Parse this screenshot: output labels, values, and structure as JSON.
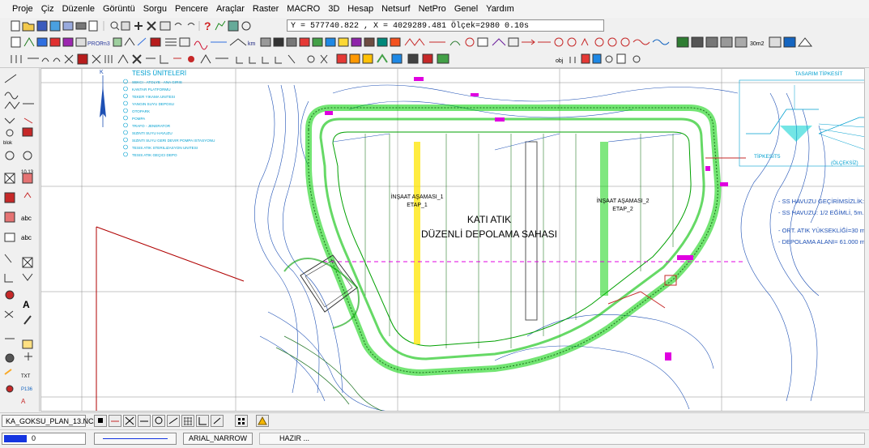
{
  "menu": [
    "Proje",
    "Çiz",
    "Düzenle",
    "Görüntü",
    "Sorgu",
    "Pencere",
    "Araçlar",
    "Raster",
    "MACRO",
    "3D",
    "Hesap",
    "Netsurf",
    "NetPro",
    "Genel",
    "Yardım"
  ],
  "coord_readout": "Y = 577740.822 , X = 4029289.481  Ölçek=2980   0.10s",
  "drawing": {
    "site_title_line1": "KATI ATIK",
    "site_title_line2": "DÜZENLİ DEPOLAMA SAHASI",
    "stage1_line1": "İNŞAAT AŞAMASI_1",
    "stage1_line2": "ETAP_1",
    "stage2_line1": "İNŞAAT AŞAMASI_2",
    "stage2_line2": "ETAP_2",
    "legend_title": "TESİS ÜNİTELERİ",
    "legend_items": [
      "SEKCI - ATOLYE - ANA GIRIS",
      "KANTAR PLATFORMU",
      "TEKER YIKAMA UNITESI",
      "YANGIN SUYU DEPOSU",
      "OTOPARK",
      "POMPA",
      "TRAFO - JENERATOR",
      "SIZINTI SUYU HAVUZU",
      "SIZINTI SUYU GERI DEVIR POMPA ISTASYONU",
      "TESIS ATIK STERILIZASYON UNITESI",
      "TESIS ATIK GEÇICI DEPO"
    ],
    "notes": [
      "- SS HAVUZU GEÇİRİMSİZLİK:  J",
      "- SS HAVUZU: 1/2 EĞİMLİ, 5m. D",
      "- ORT. ATIK YÜKSEKLİĞİ=30 m.",
      "- DEPOLAMA ALANI= 61.000 m2."
    ],
    "detail_title": "TASARIM TİPKESİT",
    "detail_label": "TİPKESİT5",
    "north_label": "K"
  },
  "status": {
    "file_tab": "KA_GOKSU_PLAN_13.NCZ",
    "layer": "0",
    "font": "ARIAL_NARROW",
    "message": "HAZIR ..."
  },
  "colors": {
    "layer": "#1535e0",
    "contour": "#1e50b4",
    "road": "#00d000",
    "highlight": "#ffe600",
    "annotation": "#e000e0",
    "boundary": "#b00000"
  }
}
